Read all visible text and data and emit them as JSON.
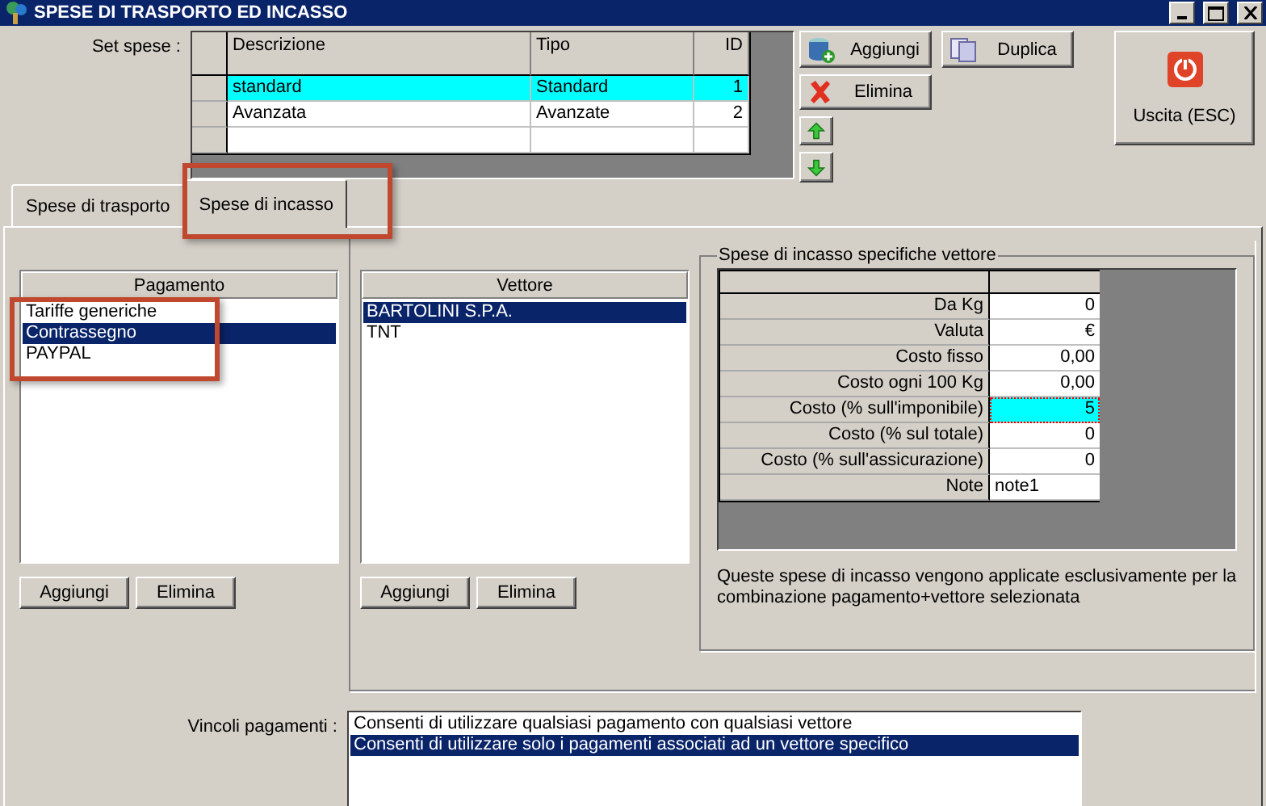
{
  "window": {
    "title": "SPESE DI TRASPORTO ED INCASSO"
  },
  "set_spese": {
    "label": "Set spese :",
    "columns": [
      "Descrizione",
      "Tipo",
      "ID"
    ],
    "rows": [
      {
        "cells": [
          "standard",
          "Standard",
          "1"
        ],
        "selected": true
      },
      {
        "cells": [
          "Avanzata",
          "Avanzate",
          "2"
        ],
        "selected": false
      }
    ]
  },
  "buttons": [
    {
      "kind": "add",
      "label": "Aggiungi"
    },
    {
      "kind": "duplicate",
      "label": "Duplica"
    },
    {
      "kind": "delete",
      "label": "Elimina"
    },
    {
      "kind": "up"
    },
    {
      "kind": "down"
    }
  ],
  "exit_button": {
    "label": "Uscita (ESC)"
  },
  "tabs": [
    {
      "label": "Spese di trasporto",
      "selected": false,
      "highlighted": false
    },
    {
      "label": "Spese di incasso",
      "selected": true,
      "highlighted": true
    }
  ],
  "payments": {
    "heading": "Pagamento",
    "highlighted": true,
    "items": [
      {
        "label": "Tariffe generiche",
        "selected": false
      },
      {
        "label": "Contrassegno",
        "selected": true
      },
      {
        "label": "PAYPAL",
        "selected": false
      }
    ],
    "buttons": [
      "Aggiungi",
      "Elimina"
    ]
  },
  "carriers": {
    "heading": "Vettore",
    "items": [
      {
        "label": "BARTOLINI S.P.A.",
        "selected": true
      },
      {
        "label": "TNT",
        "selected": false
      }
    ],
    "buttons": [
      "Aggiungi",
      "Elimina"
    ]
  },
  "specific": {
    "title": "Spese di incasso specifiche vettore",
    "rows": [
      {
        "label": "Da Kg",
        "value": "0",
        "kind": "number",
        "selected": false
      },
      {
        "label": "Valuta",
        "value": "€",
        "kind": "number",
        "selected": false
      },
      {
        "label": "Costo fisso",
        "value": "0,00",
        "kind": "number",
        "selected": false
      },
      {
        "label": "Costo ogni 100 Kg",
        "value": "0,00",
        "kind": "number",
        "selected": false
      },
      {
        "label": "Costo (% sull'imponibile)",
        "value": "5",
        "kind": "number",
        "selected": true
      },
      {
        "label": "Costo (% sul totale)",
        "value": "0",
        "kind": "number",
        "selected": false
      },
      {
        "label": "Costo (% sull'assicurazione)",
        "value": "0",
        "kind": "number",
        "selected": false
      },
      {
        "label": "Note",
        "value": "note1",
        "kind": "text",
        "selected": false
      }
    ],
    "note": "Queste spese di incasso vengono applicate esclusivamente per la combinazione pagamento+vettore selezionata"
  },
  "constraints": {
    "label": "Vincoli pagamenti :",
    "items": [
      {
        "label": "Consenti di utilizzare qualsiasi pagamento con qualsiasi vettore",
        "selected": false
      },
      {
        "label": "Consenti di utilizzare solo i pagamenti associati ad un vettore specifico",
        "selected": true
      }
    ]
  }
}
